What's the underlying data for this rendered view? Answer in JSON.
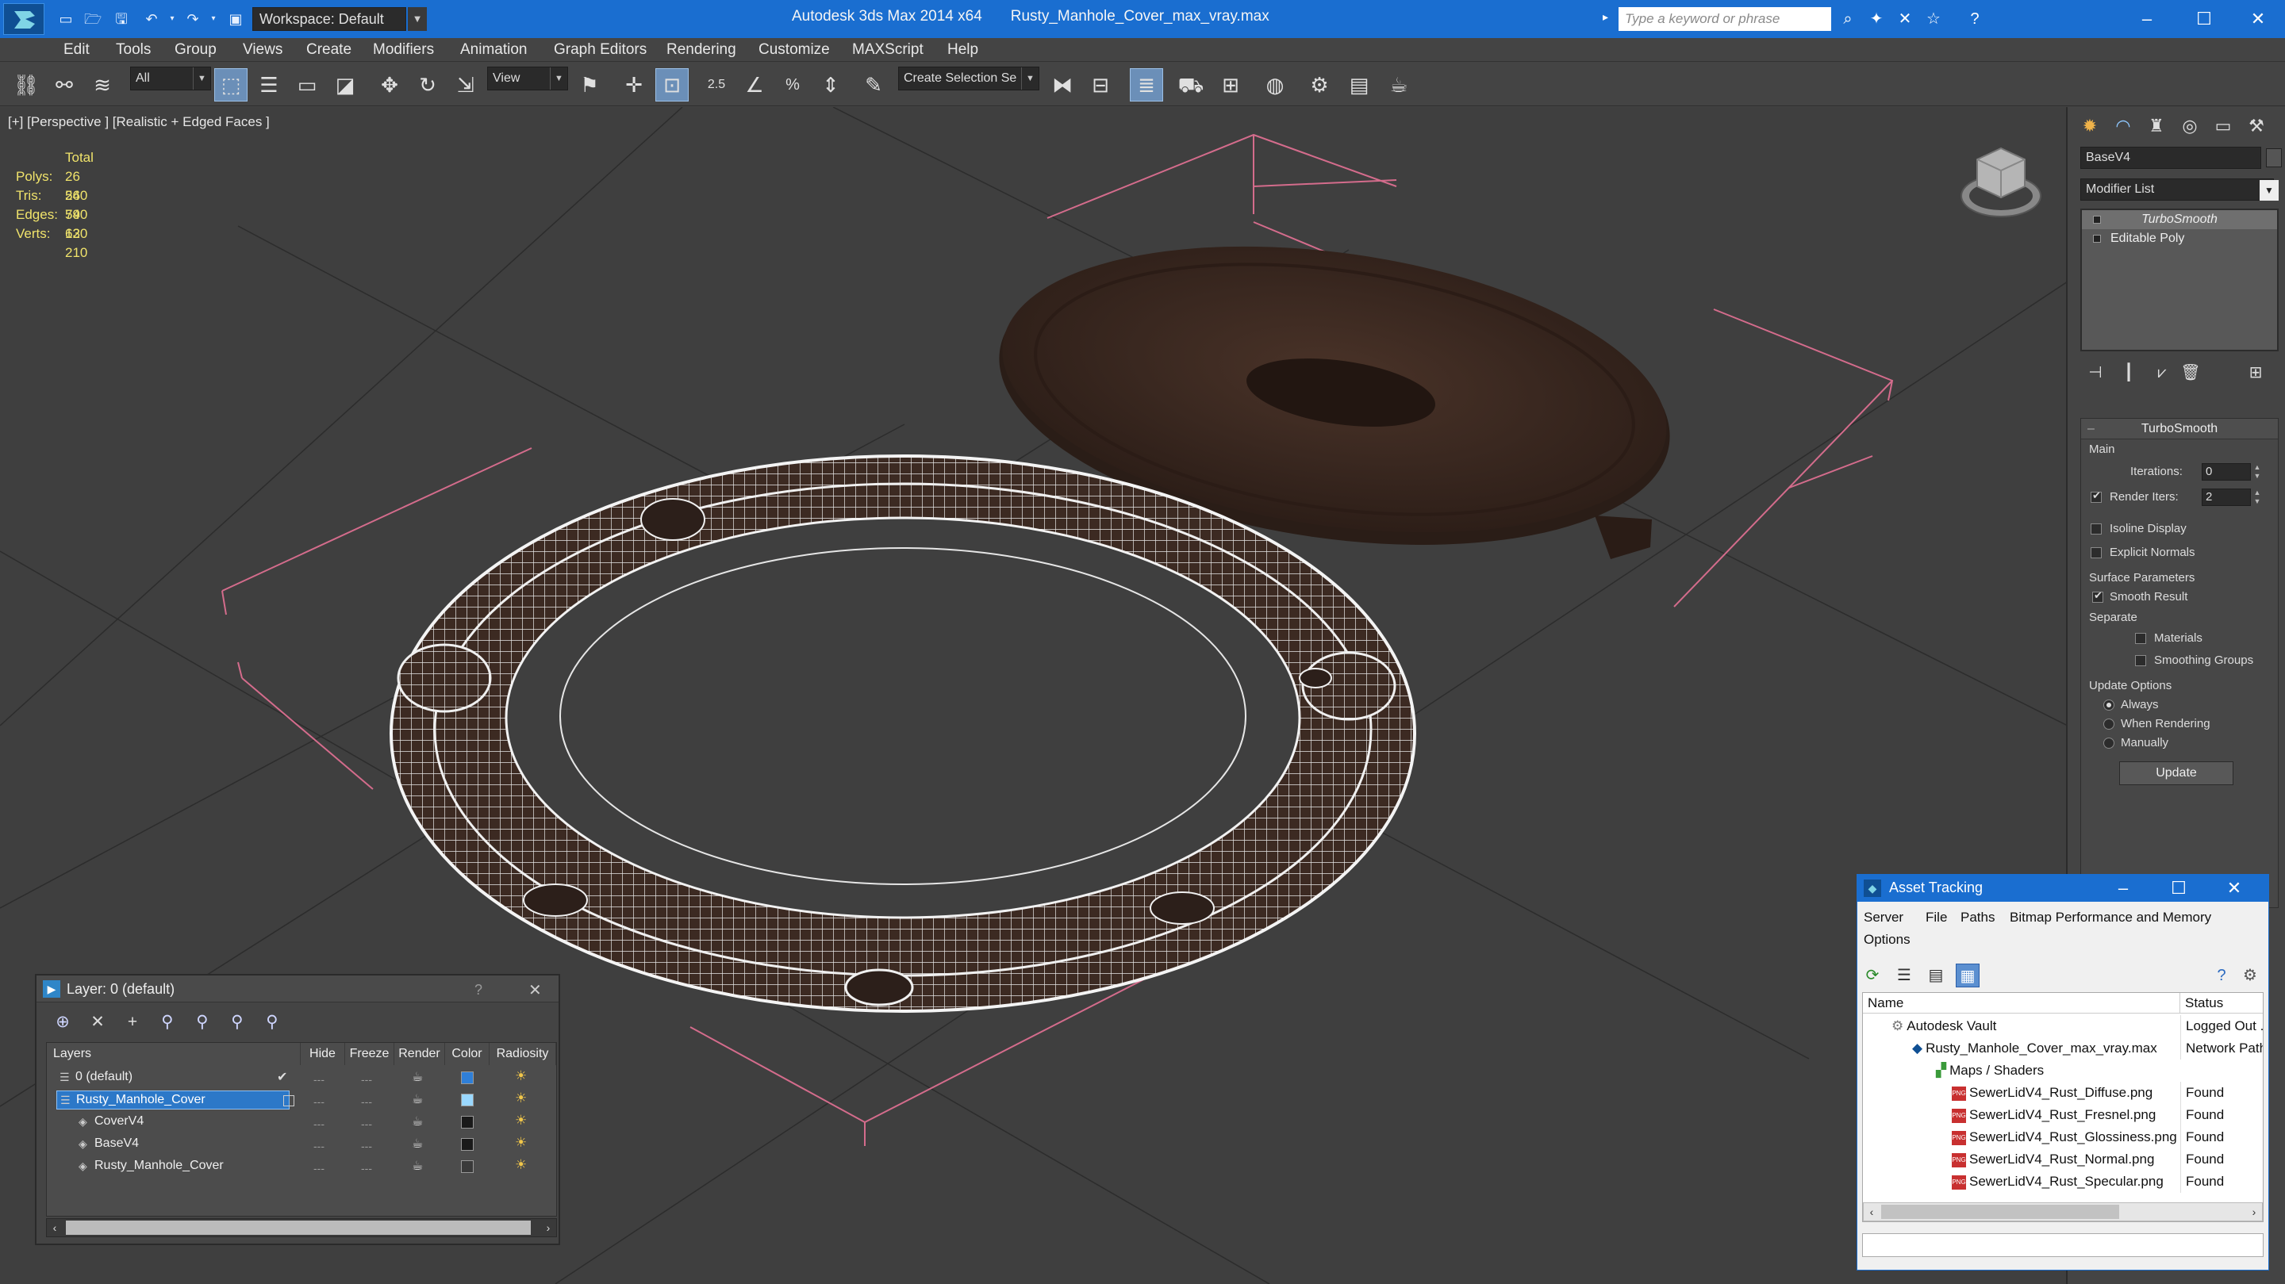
{
  "titlebar": {
    "app": "Autodesk 3ds Max  2014 x64",
    "file": "Rusty_Manhole_Cover_max_vray.max",
    "workspace": "Workspace: Default",
    "search_placeholder": "Type a keyword or phrase"
  },
  "menu": [
    "Edit",
    "Tools",
    "Group",
    "Views",
    "Create",
    "Modifiers",
    "Animation",
    "Graph Editors",
    "Rendering",
    "Customize",
    "MAXScript",
    "Help"
  ],
  "toolbar": {
    "selection_filter": "All",
    "ref_coord": "View",
    "snap_25": "2.5",
    "percent": "%",
    "named_selection": "Create Selection Se"
  },
  "viewport": {
    "label": "[+] [Perspective ] [Realistic + Edged Faces ]",
    "stats": {
      "header": "Total",
      "rows": [
        {
          "k": "Polys:",
          "v": "26 540"
        },
        {
          "k": "Tris:",
          "v": "26 540"
        },
        {
          "k": "Edges:",
          "v": "79 620"
        },
        {
          "k": "Verts:",
          "v": "13 210"
        }
      ]
    }
  },
  "command_panel": {
    "object_name": "BaseV4",
    "modifier_list": "Modifier List",
    "stack": [
      "TurboSmooth",
      "Editable Poly"
    ],
    "turbosmooth": {
      "title": "TurboSmooth",
      "main": "Main",
      "iterations_label": "Iterations:",
      "iterations": "0",
      "render_iters_label": "Render Iters:",
      "render_iters": "2",
      "isoline": "Isoline Display",
      "explicit_normals": "Explicit Normals",
      "surface_params": "Surface Parameters",
      "smooth_result": "Smooth Result",
      "separate": "Separate",
      "materials": "Materials",
      "smoothing_groups": "Smoothing Groups",
      "update_options": "Update Options",
      "always": "Always",
      "when_rendering": "When Rendering",
      "manually": "Manually",
      "update": "Update"
    }
  },
  "layer_window": {
    "title": "Layer: 0 (default)",
    "help": "?",
    "headers": [
      "Layers",
      "Hide",
      "Freeze",
      "Render",
      "Color",
      "Radiosity"
    ],
    "rows": [
      {
        "name": "0 (default)",
        "color": "#2f7fd8"
      },
      {
        "name": "Rusty_Manhole_Cover",
        "color": "#9ad8ff"
      },
      {
        "name": "CoverV4",
        "color": "#1a1a1a"
      },
      {
        "name": "BaseV4",
        "color": "#1a1a1a"
      },
      {
        "name": "Rusty_Manhole_Cover",
        "color": "#3a3a3a"
      }
    ]
  },
  "asset_window": {
    "title": "Asset Tracking",
    "menu": [
      "Server",
      "File",
      "Paths",
      "Bitmap Performance and Memory",
      "Options"
    ],
    "headers": [
      "Name",
      "Status"
    ],
    "rows": [
      {
        "name": "Autodesk Vault",
        "status": "Logged Out ..."
      },
      {
        "name": "Rusty_Manhole_Cover_max_vray.max",
        "status": "Network Path"
      },
      {
        "name": "Maps / Shaders",
        "status": ""
      },
      {
        "name": "SewerLidV4_Rust_Diffuse.png",
        "status": "Found"
      },
      {
        "name": "SewerLidV4_Rust_Fresnel.png",
        "status": "Found"
      },
      {
        "name": "SewerLidV4_Rust_Glossiness.png",
        "status": "Found"
      },
      {
        "name": "SewerLidV4_Rust_Normal.png",
        "status": "Found"
      },
      {
        "name": "SewerLidV4_Rust_Specular.png",
        "status": "Found"
      }
    ]
  },
  "colors": {
    "titlebar": "#1a6ed0",
    "stats": "#f0e36b",
    "selection": "#2c78c8",
    "ui_bg": "#444444"
  }
}
